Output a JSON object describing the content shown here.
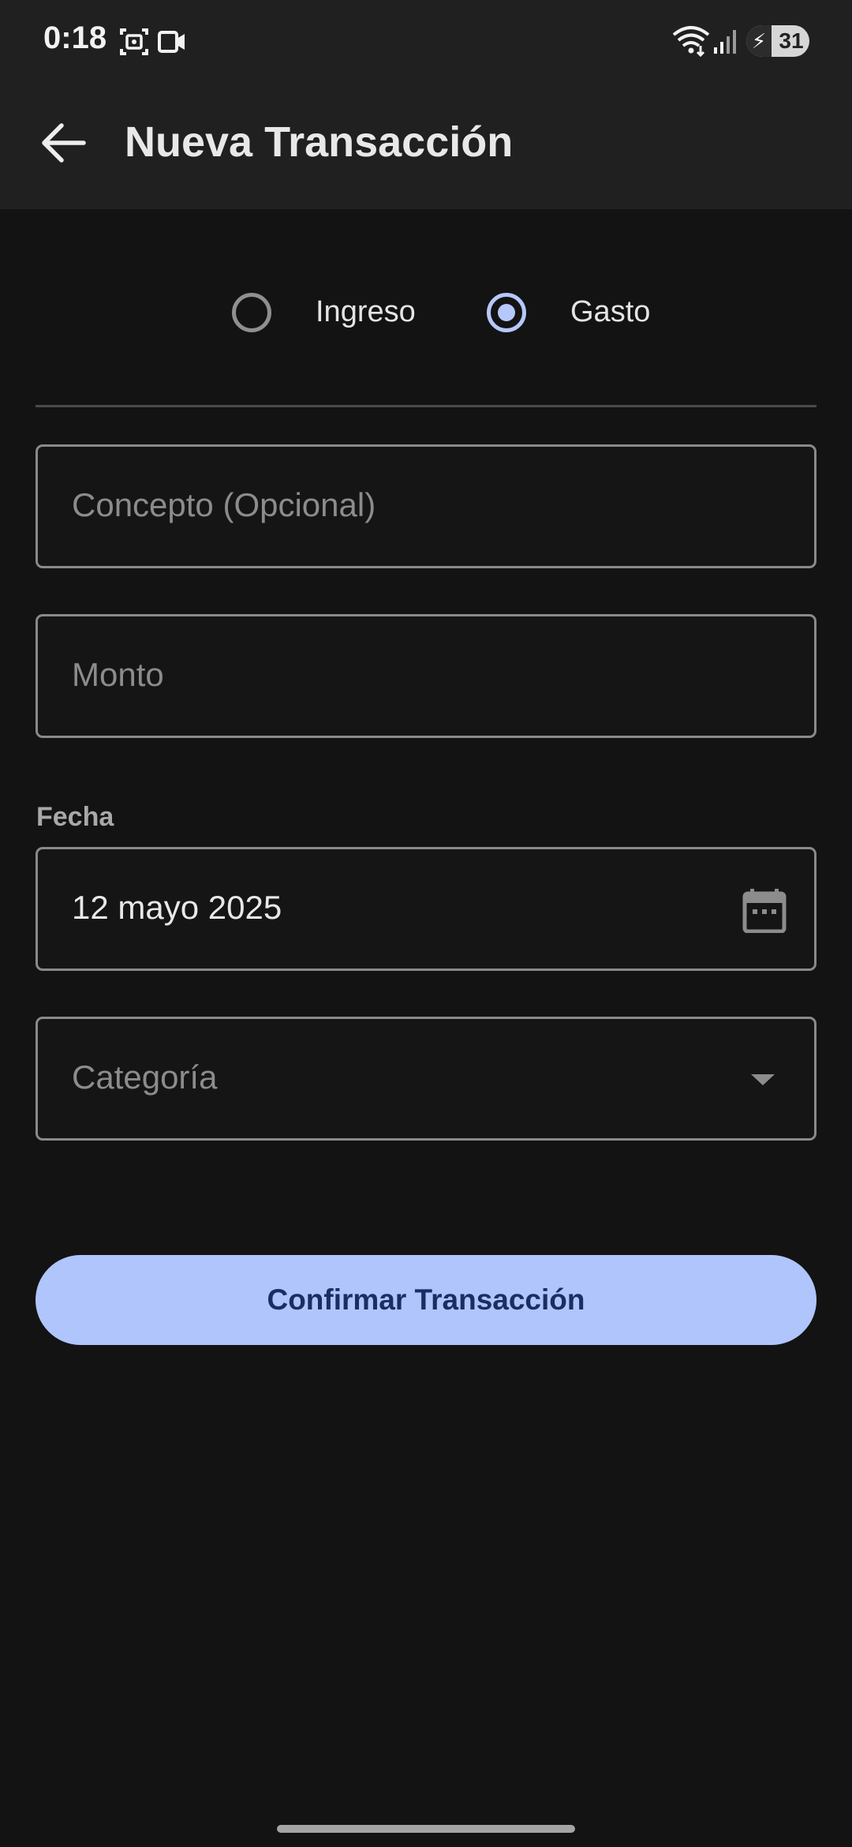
{
  "status_bar": {
    "time": "0:18",
    "battery_level": "31",
    "icons": [
      "screenshot-icon",
      "screen-record-icon",
      "wifi-icon",
      "signal-icon",
      "battery-charging-icon"
    ]
  },
  "app_bar": {
    "title": "Nueva Transacción",
    "back_icon": "arrow-back-icon"
  },
  "transaction_type": {
    "options": [
      {
        "label": "Ingreso",
        "selected": false
      },
      {
        "label": "Gasto",
        "selected": true
      }
    ]
  },
  "form": {
    "concepto": {
      "placeholder": "Concepto (Opcional)",
      "value": ""
    },
    "monto": {
      "placeholder": "Monto",
      "value": ""
    },
    "fecha": {
      "label": "Fecha",
      "value": "12 mayo 2025",
      "icon": "calendar-icon"
    },
    "categoria": {
      "placeholder": "Categoría",
      "value": "",
      "icon": "dropdown-arrow-icon"
    }
  },
  "actions": {
    "confirm_label": "Confirmar Transacción"
  },
  "colors": {
    "background": "#131313",
    "app_bar": "#202020",
    "accent": "#b6c8fb",
    "button_fill": "#b0c5fc",
    "button_text": "#1b2e64",
    "outline": "#8a8a8a"
  }
}
